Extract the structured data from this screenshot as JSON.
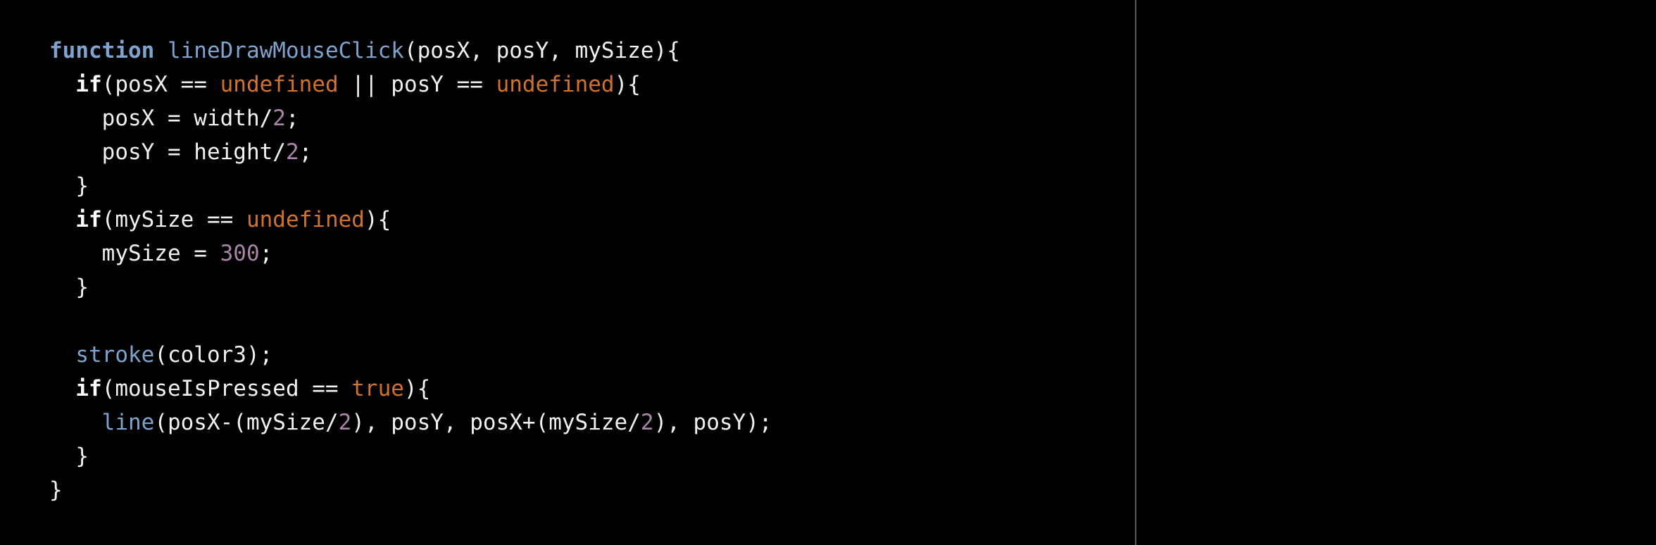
{
  "code_lines": [
    [
      {
        "t": "kwfn",
        "v": "function"
      },
      {
        "t": "",
        "v": " "
      },
      {
        "t": "fn",
        "v": "lineDrawMouseClick"
      },
      {
        "t": "",
        "v": "(posX, posY, mySize){"
      }
    ],
    [
      {
        "t": "",
        "v": "  "
      },
      {
        "t": "kw",
        "v": "if"
      },
      {
        "t": "",
        "v": "(posX == "
      },
      {
        "t": "const",
        "v": "undefined"
      },
      {
        "t": "",
        "v": " || posY == "
      },
      {
        "t": "const",
        "v": "undefined"
      },
      {
        "t": "",
        "v": "){"
      }
    ],
    [
      {
        "t": "",
        "v": "    posX = width/"
      },
      {
        "t": "num",
        "v": "2"
      },
      {
        "t": "",
        "v": ";"
      }
    ],
    [
      {
        "t": "",
        "v": "    posY = height/"
      },
      {
        "t": "num",
        "v": "2"
      },
      {
        "t": "",
        "v": ";"
      }
    ],
    [
      {
        "t": "",
        "v": "  }"
      }
    ],
    [
      {
        "t": "",
        "v": "  "
      },
      {
        "t": "kw",
        "v": "if"
      },
      {
        "t": "",
        "v": "(mySize == "
      },
      {
        "t": "const",
        "v": "undefined"
      },
      {
        "t": "",
        "v": "){"
      }
    ],
    [
      {
        "t": "",
        "v": "    mySize = "
      },
      {
        "t": "num",
        "v": "300"
      },
      {
        "t": "",
        "v": ";"
      }
    ],
    [
      {
        "t": "",
        "v": "  }"
      }
    ],
    [
      {
        "t": "",
        "v": ""
      }
    ],
    [
      {
        "t": "",
        "v": "  "
      },
      {
        "t": "fn",
        "v": "stroke"
      },
      {
        "t": "",
        "v": "(color3);"
      }
    ],
    [
      {
        "t": "",
        "v": "  "
      },
      {
        "t": "kw",
        "v": "if"
      },
      {
        "t": "",
        "v": "(mouseIsPressed == "
      },
      {
        "t": "const",
        "v": "true"
      },
      {
        "t": "",
        "v": "){"
      }
    ],
    [
      {
        "t": "",
        "v": "    "
      },
      {
        "t": "fn",
        "v": "line"
      },
      {
        "t": "",
        "v": "(posX-(mySize/"
      },
      {
        "t": "num",
        "v": "2"
      },
      {
        "t": "",
        "v": "), posY, posX+(mySize/"
      },
      {
        "t": "num",
        "v": "2"
      },
      {
        "t": "",
        "v": "), posY);"
      }
    ],
    [
      {
        "t": "",
        "v": "  }"
      }
    ],
    [
      {
        "t": "",
        "v": "}"
      }
    ]
  ],
  "colors": {
    "keyword_fn": "#7fa3cf",
    "constant": "#d2732c",
    "number": "#a886a8",
    "text": "#f2f2f2",
    "background": "#000000"
  }
}
